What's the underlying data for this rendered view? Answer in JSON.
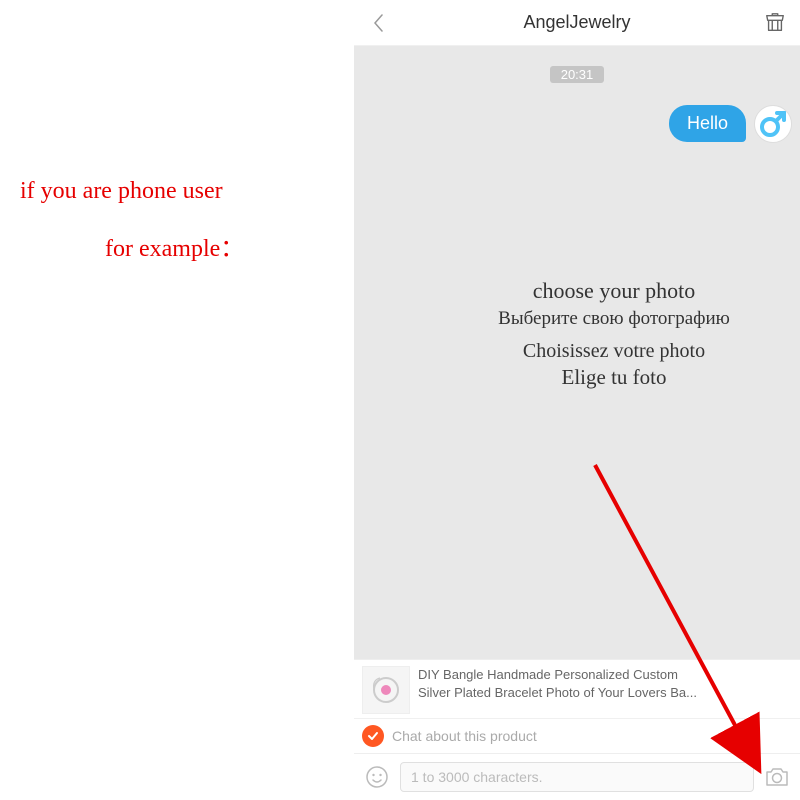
{
  "annotation": {
    "line1": "if you are phone user",
    "line2": "for example："
  },
  "header": {
    "title": "AngelJewelry"
  },
  "chat": {
    "timestamp": "20:31",
    "message": "Hello"
  },
  "overlay": {
    "en": "choose your photo",
    "ru": "Выберите свою фотографию",
    "fr": "Choisissez votre photo",
    "es": "Elige tu foto"
  },
  "product": {
    "line1": "DIY Bangle Handmade Personalized Custom",
    "line2": "Silver Plated Bracelet Photo of Your Lovers Ba..."
  },
  "chatAbout": {
    "label": "Chat about this product"
  },
  "input": {
    "placeholder": "1 to 3000 characters."
  },
  "colors": {
    "accent_red": "#e60000",
    "bubble_blue": "#2fa4e7",
    "check_orange": "#ff5722",
    "male_blue": "#4fc3f7"
  }
}
